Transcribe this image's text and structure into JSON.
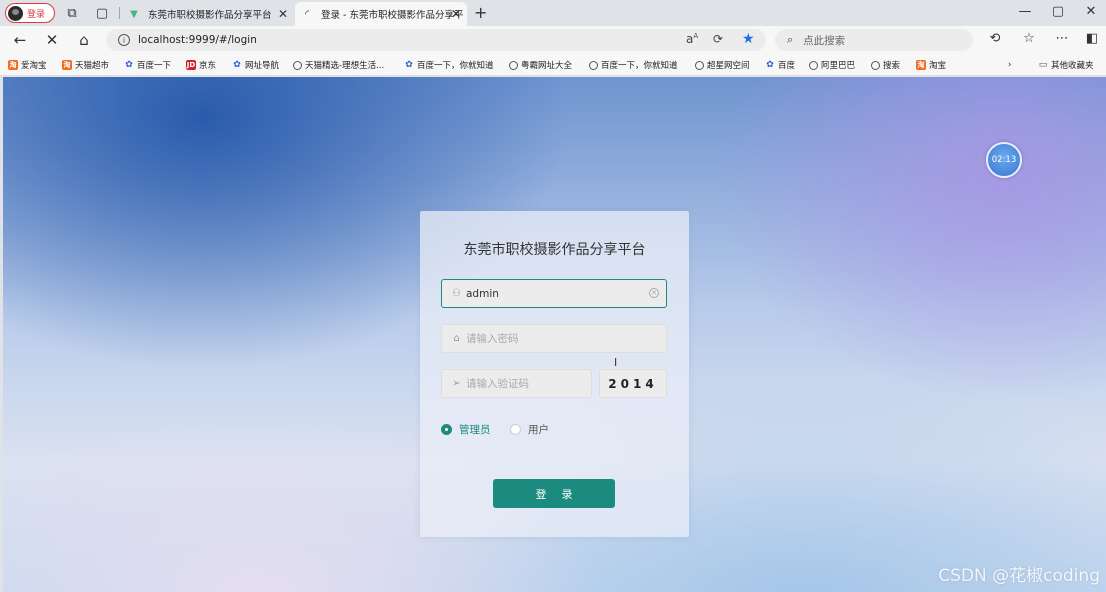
{
  "browser": {
    "profile_label": "登录",
    "tabs": [
      {
        "title": "东莞市职校摄影作品分享平台",
        "favicon": "vue-logo-icon",
        "active": false
      },
      {
        "title": "登录 - 东莞市职校摄影作品分享平",
        "favicon": "loading-icon",
        "active": true
      }
    ],
    "url": "localhost:9999/#/login",
    "search_placeholder": "点此搜索",
    "bookmarks": [
      {
        "label": "爱淘宝",
        "icon": "taobao"
      },
      {
        "label": "天猫超市",
        "icon": "taobao"
      },
      {
        "label": "百度一下",
        "icon": "baidu"
      },
      {
        "label": "京东",
        "icon": "jd"
      },
      {
        "label": "网址导航",
        "icon": "baidu"
      },
      {
        "label": "天猫精选-理想生活...",
        "icon": "globe"
      },
      {
        "label": "百度一下，你就知道",
        "icon": "baidu"
      },
      {
        "label": "粤霸网址大全",
        "icon": "globe"
      },
      {
        "label": "百度一下，你就知道",
        "icon": "globe"
      },
      {
        "label": "超星网空间",
        "icon": "globe"
      },
      {
        "label": "百度",
        "icon": "baidu"
      },
      {
        "label": "阿里巴巴",
        "icon": "globe"
      },
      {
        "label": "搜索",
        "icon": "globe"
      },
      {
        "label": "淘宝",
        "icon": "taobao"
      }
    ],
    "other_bookmarks": "其他收藏夹"
  },
  "page": {
    "clock": "02:13",
    "title": "东莞市职校摄影作品分享平台",
    "username_value": "admin",
    "password_placeholder": "请输入密码",
    "code_placeholder": "请输入验证码",
    "captcha": "2014",
    "roles": [
      {
        "label": "管理员",
        "selected": true
      },
      {
        "label": "用户",
        "selected": false
      }
    ],
    "login_label": "登 录",
    "accent_color": "#1c8b7f"
  },
  "watermark": "CSDN @花椒coding"
}
